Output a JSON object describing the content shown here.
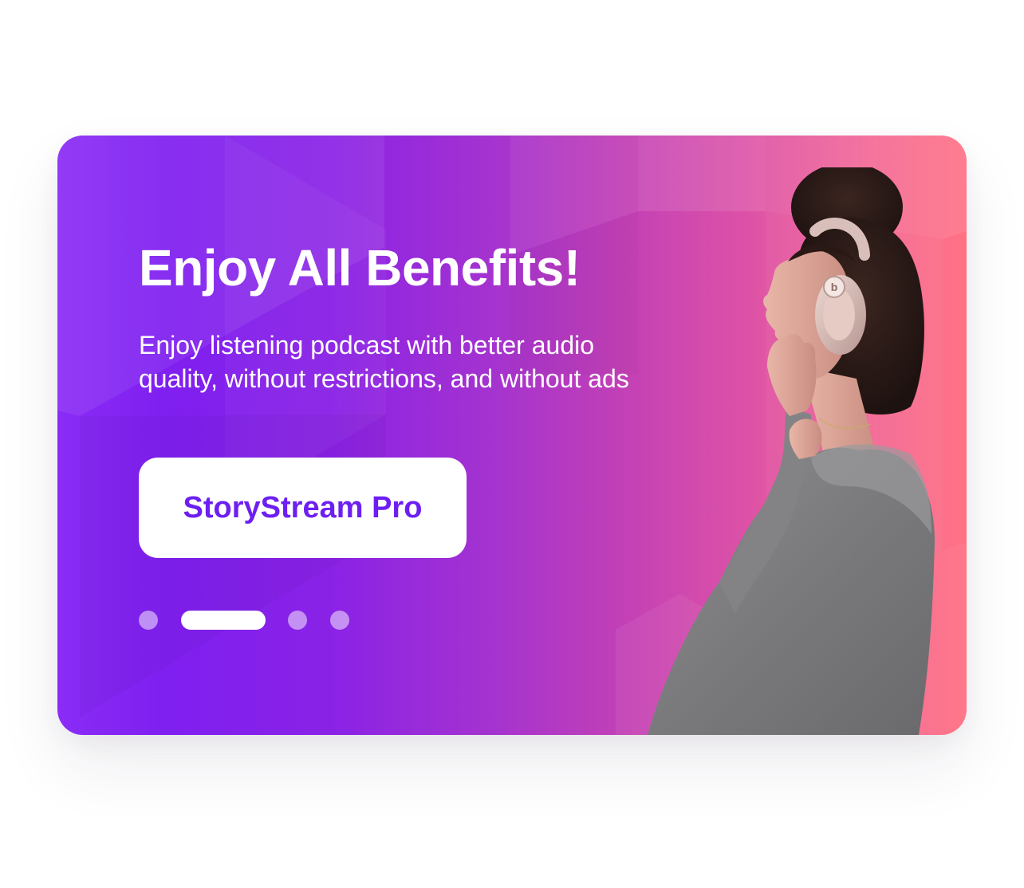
{
  "promo": {
    "title": "Enjoy All Benefits!",
    "description": "Enjoy listening podcast with better audio quality, without restrictions, and without ads",
    "cta_label": "StoryStream Pro"
  },
  "carousel": {
    "slide_count": 4,
    "active_index": 1
  },
  "colors": {
    "gradient_start": "#8a2cf6",
    "gradient_end": "#ff7285",
    "cta_text": "#6d1ff2",
    "text": "#ffffff"
  },
  "image": {
    "icon": "woman-with-headphones-photo"
  }
}
